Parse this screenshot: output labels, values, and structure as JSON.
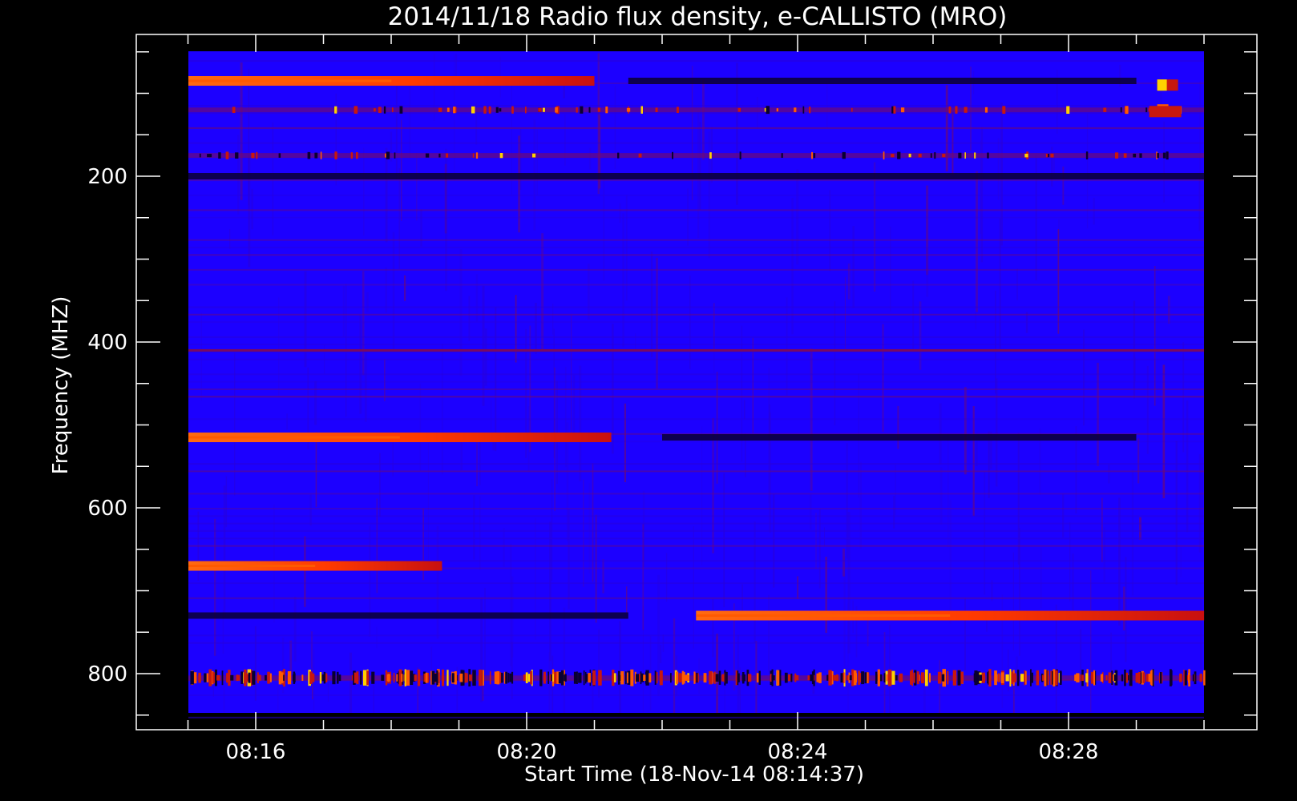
{
  "chart_data": {
    "type": "heatmap",
    "title": "2014/11/18  Radio flux density, e-CALLISTO (MRO)",
    "xlabel": "Start Time (18-Nov-14 08:14:37)",
    "ylabel": "Frequency (MHZ)",
    "x_axis": {
      "unit": "minutes",
      "data_start": "08:14:37",
      "data_end": "08:30:00",
      "major_ticks": [
        "08:16",
        "08:20",
        "08:24",
        "08:28"
      ],
      "minor_interval_minutes": 1
    },
    "y_axis": {
      "unit": "MHz",
      "direction": "top-to-bottom increasing",
      "range": [
        45,
        870
      ],
      "major_ticks": [
        200,
        400,
        600,
        800
      ],
      "minor_interval": 50
    },
    "colormap": [
      "#1c00ff",
      "#2a00d8",
      "#0a0030",
      "#7a0a60",
      "#c8180e",
      "#ff5a00",
      "#ffd200"
    ],
    "bands": [
      {
        "freq": 85,
        "from": "08:14:37",
        "to": "08:21:00",
        "level": "bright"
      },
      {
        "freq": 85,
        "from": "08:21:30",
        "to": "08:29:00",
        "level": "dark"
      },
      {
        "freq": 120,
        "from": "08:14:37",
        "to": "08:30:00",
        "level": "spotty"
      },
      {
        "freq": 175,
        "from": "08:14:37",
        "to": "08:30:00",
        "level": "spotty"
      },
      {
        "freq": 200,
        "from": "08:14:37",
        "to": "08:30:00",
        "level": "dark"
      },
      {
        "freq": 410,
        "from": "08:14:37",
        "to": "08:30:00",
        "level": "faint"
      },
      {
        "freq": 515,
        "from": "08:14:37",
        "to": "08:21:15",
        "level": "bright"
      },
      {
        "freq": 515,
        "from": "08:22:00",
        "to": "08:29:00",
        "level": "dark"
      },
      {
        "freq": 670,
        "from": "08:14:37",
        "to": "08:18:45",
        "level": "bright"
      },
      {
        "freq": 730,
        "from": "08:14:37",
        "to": "08:21:30",
        "level": "dark"
      },
      {
        "freq": 730,
        "from": "08:22:30",
        "to": "08:30:00",
        "level": "bright"
      },
      {
        "freq": 805,
        "from": "08:14:37",
        "to": "08:30:00",
        "level": "spotty"
      }
    ],
    "grid": false,
    "legend": "none"
  }
}
